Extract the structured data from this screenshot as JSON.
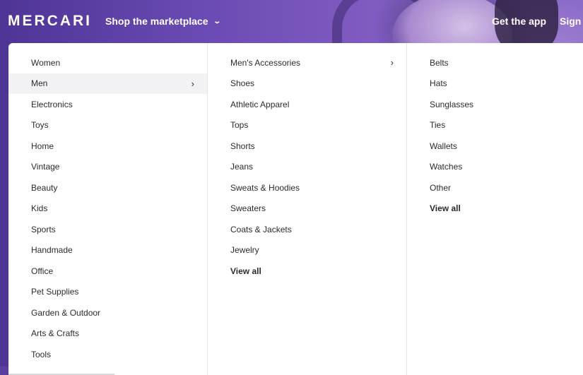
{
  "header": {
    "logo": "MERCARI",
    "shop_menu": "Shop the marketplace",
    "get_app": "Get the app",
    "sign_up": "Sign u"
  },
  "categories": [
    {
      "label": "Women"
    },
    {
      "label": "Men",
      "active": true
    },
    {
      "label": "Electronics"
    },
    {
      "label": "Toys"
    },
    {
      "label": "Home"
    },
    {
      "label": "Vintage"
    },
    {
      "label": "Beauty"
    },
    {
      "label": "Kids"
    },
    {
      "label": "Sports"
    },
    {
      "label": "Handmade"
    },
    {
      "label": "Office"
    },
    {
      "label": "Pet Supplies"
    },
    {
      "label": "Garden & Outdoor"
    },
    {
      "label": "Arts & Crafts"
    },
    {
      "label": "Tools"
    }
  ],
  "men_subcategories": [
    {
      "label": "Men's Accessories",
      "has_children": true
    },
    {
      "label": "Shoes"
    },
    {
      "label": "Athletic Apparel"
    },
    {
      "label": "Tops"
    },
    {
      "label": "Shorts"
    },
    {
      "label": "Jeans"
    },
    {
      "label": "Sweats & Hoodies"
    },
    {
      "label": "Sweaters"
    },
    {
      "label": "Coats & Jackets"
    },
    {
      "label": "Jewelry"
    },
    {
      "label": "View all",
      "view_all": true
    }
  ],
  "accessories_subcategories": [
    {
      "label": "Belts"
    },
    {
      "label": "Hats"
    },
    {
      "label": "Sunglasses"
    },
    {
      "label": "Ties"
    },
    {
      "label": "Wallets"
    },
    {
      "label": "Watches"
    },
    {
      "label": "Other"
    },
    {
      "label": "View all",
      "view_all": true
    }
  ],
  "icons": {
    "shop_chevron": "chevron-down-icon",
    "item_caret": "chevron-right-icon"
  }
}
